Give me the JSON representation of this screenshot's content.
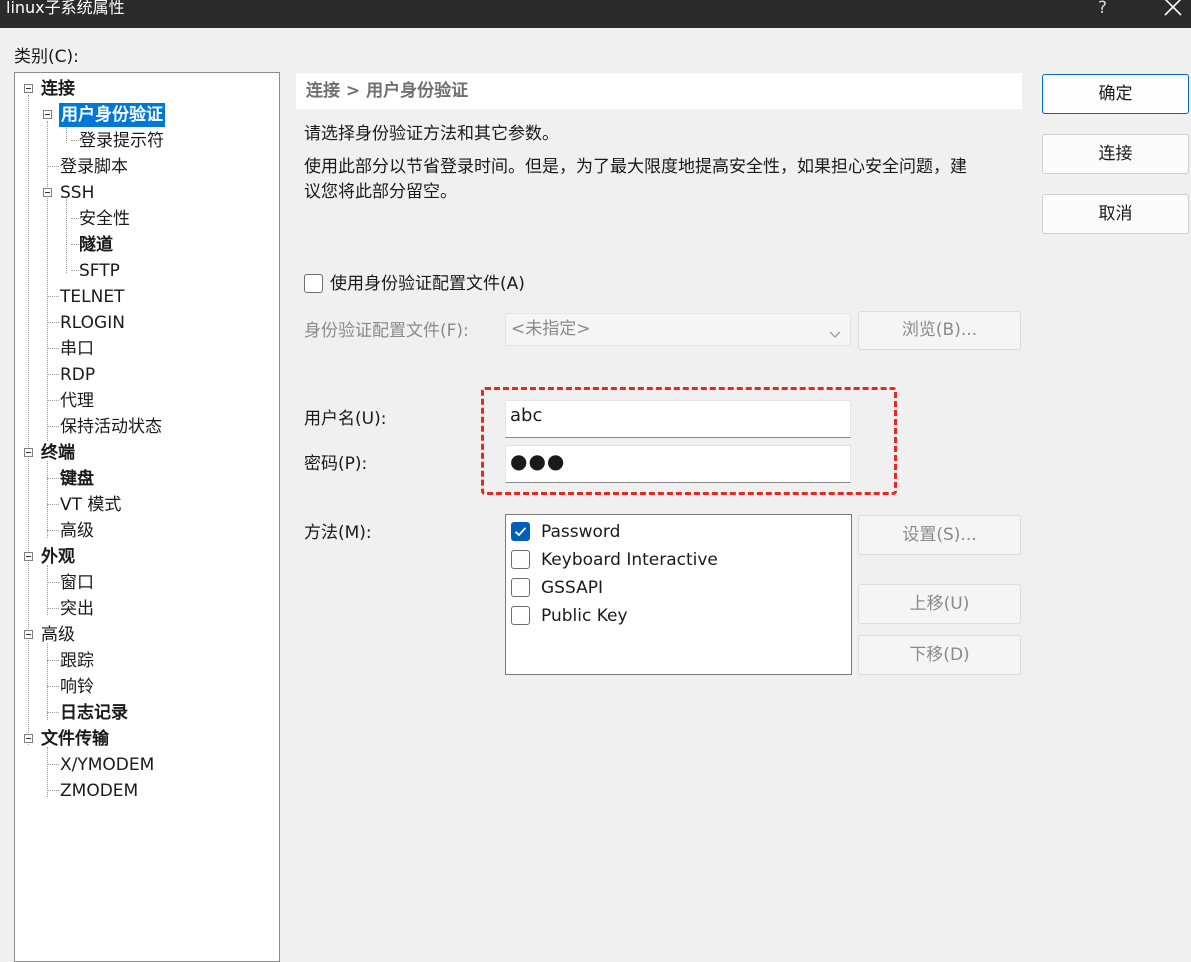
{
  "window": {
    "title": "linux子系统属性",
    "help_glyph": "?"
  },
  "category_label": "类别(C):",
  "tree": {
    "connection": "连接",
    "auth": "用户身份验证",
    "login_prompt": "登录提示符",
    "login_script": "登录脚本",
    "ssh": "SSH",
    "security": "安全性",
    "tunnel": "隧道",
    "sftp": "SFTP",
    "telnet": "TELNET",
    "rlogin": "RLOGIN",
    "serial": "串口",
    "rdp": "RDP",
    "proxy": "代理",
    "keepalive": "保持活动状态",
    "terminal": "终端",
    "keyboard": "键盘",
    "vt_mode": "VT 模式",
    "terminal_advanced": "高级",
    "appearance": "外观",
    "window": "窗口",
    "highlight": "突出",
    "advanced": "高级",
    "trace": "跟踪",
    "bell": "响铃",
    "logging": "日志记录",
    "file_transfer": "文件传输",
    "xymodem": "X/YMODEM",
    "zmodem": "ZMODEM"
  },
  "breadcrumb": "连接 > 用户身份验证",
  "desc1": "请选择身份验证方法和其它参数。",
  "desc2a": "使用此部分以节省登录时间。但是，为了最大限度地提高安全性，如果担心安全问题，建",
  "desc2b": "议您将此部分留空。",
  "use_profile": {
    "label": "使用身份验证配置文件(A)",
    "checked": false
  },
  "profile_file": {
    "label": "身份验证配置文件(F):",
    "value": "<未指定>",
    "browse": "浏览(B)..."
  },
  "username": {
    "label": "用户名(U):",
    "value": "abc"
  },
  "password": {
    "label": "密码(P):",
    "value": "●●●"
  },
  "method": {
    "label": "方法(M):",
    "items": [
      {
        "label": "Password",
        "checked": true
      },
      {
        "label": "Keyboard Interactive",
        "checked": false
      },
      {
        "label": "GSSAPI",
        "checked": false
      },
      {
        "label": "Public Key",
        "checked": false
      }
    ],
    "settings": "设置(S)...",
    "move_up": "上移(U)",
    "move_down": "下移(D)"
  },
  "buttons": {
    "ok": "确定",
    "connect": "连接",
    "cancel": "取消"
  },
  "colors": {
    "accent": "#0078d7",
    "highlight_box": "#e8281e",
    "titlebar": "#2b2b2b"
  }
}
